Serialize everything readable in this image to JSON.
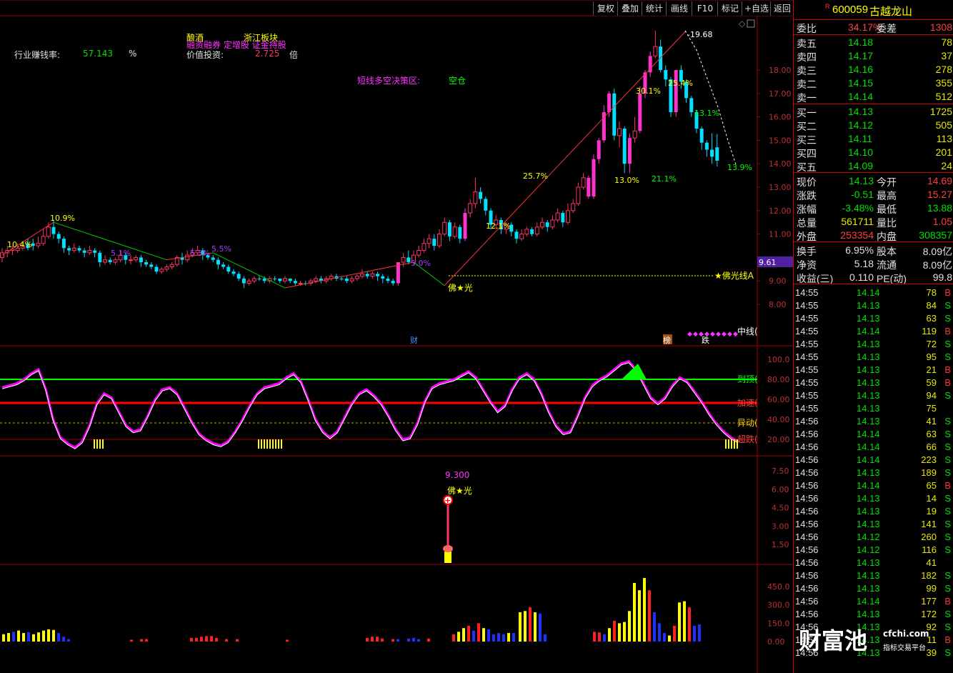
{
  "toolbar": [
    "复权",
    "叠加",
    "统计",
    "画线",
    "F10",
    "标记",
    "+自选",
    "返回"
  ],
  "stock": {
    "flag": "R",
    "code": "600059",
    "name": "古越龙山"
  },
  "overlay": {
    "industry_label": "行业赚钱率:",
    "industry_value": "57.143",
    "industry_unit": "%",
    "tag1": "酿酒",
    "tag2": "浙江板块",
    "tag3": "融资融券 定增股 证金持股",
    "value_label": "价值投资:",
    "value_value": "2.725",
    "value_unit": "倍",
    "decision_label": "短线多空决策区:",
    "decision_value": "空仓"
  },
  "price_axis": [
    "18.00",
    "17.00",
    "16.00",
    "15.00",
    "14.00",
    "13.00",
    "12.00",
    "11.00",
    "9.00",
    "8.00"
  ],
  "current_price_tag": "9.61",
  "peak_label": "19.68",
  "annotations": [
    "30.1%",
    "25.4%",
    "13.1%",
    "13.9%",
    "21.1%",
    "13.0%",
    "25.7%",
    "12.1%",
    "10.9%",
    "10.4%",
    "5.1%",
    "5.3%",
    "5.5%",
    "5.0%"
  ],
  "foguang_line_label": "★佛光线A",
  "foguang_label": "佛★光",
  "events": {
    "cai": "财",
    "bang": "榜",
    "die": "跌",
    "zhongxian": "中线("
  },
  "osc_axis": [
    "100.0",
    "80.00",
    "60.00",
    "40.00",
    "20.00"
  ],
  "osc_lines": {
    "top": "到顶(",
    "accel": "加速(",
    "move": "异动(",
    "drop": "超跌("
  },
  "ind3_axis": [
    "7.50",
    "6.00",
    "4.50",
    "3.00",
    "1.50"
  ],
  "ind3_value": "9.300",
  "vol_axis": [
    "450.0",
    "300.0",
    "150.0",
    "0.00"
  ],
  "quote": {
    "weibi_label": "委比",
    "weibi": "34.17%",
    "weicha_label": "委差",
    "weicha": "1308",
    "sell": [
      {
        "label": "卖五",
        "price": "14.18",
        "vol": "78"
      },
      {
        "label": "卖四",
        "price": "14.17",
        "vol": "37"
      },
      {
        "label": "卖三",
        "price": "14.16",
        "vol": "278"
      },
      {
        "label": "卖二",
        "price": "14.15",
        "vol": "355"
      },
      {
        "label": "卖一",
        "price": "14.14",
        "vol": "512"
      }
    ],
    "buy": [
      {
        "label": "买一",
        "price": "14.13",
        "vol": "1725"
      },
      {
        "label": "买二",
        "price": "14.12",
        "vol": "505"
      },
      {
        "label": "买三",
        "price": "14.11",
        "vol": "113"
      },
      {
        "label": "买四",
        "price": "14.10",
        "vol": "201"
      },
      {
        "label": "买五",
        "price": "14.09",
        "vol": "24"
      }
    ],
    "stats": [
      {
        "l1": "现价",
        "v1": "14.13",
        "c1": "#00e000",
        "l2": "今开",
        "v2": "14.69",
        "c2": "#ff4040"
      },
      {
        "l1": "涨跌",
        "v1": "-0.51",
        "c1": "#00e000",
        "l2": "最高",
        "v2": "15.27",
        "c2": "#ff4040"
      },
      {
        "l1": "涨幅",
        "v1": "-3.48%",
        "c1": "#00e000",
        "l2": "最低",
        "v2": "13.88",
        "c2": "#00e000"
      },
      {
        "l1": "总量",
        "v1": "561711",
        "c1": "#e8e800",
        "l2": "量比",
        "v2": "1.05",
        "c2": "#ff4040"
      },
      {
        "l1": "外盘",
        "v1": "253354",
        "c1": "#ff4040",
        "l2": "内盘",
        "v2": "308357",
        "c2": "#00e000"
      }
    ],
    "stats2": [
      {
        "l1": "换手",
        "v1": "6.95%",
        "l2": "股本",
        "v2": "8.09亿"
      },
      {
        "l1": "净资",
        "v1": "5.18",
        "l2": "流通",
        "v2": "8.09亿"
      },
      {
        "l1": "收益(三)",
        "v1": "0.110",
        "l2": "PE(动)",
        "v2": "99.8"
      }
    ]
  },
  "ticks": [
    {
      "t": "14:55",
      "p": "14.14",
      "v": "78",
      "s": "B"
    },
    {
      "t": "14:55",
      "p": "14.13",
      "v": "84",
      "s": "S"
    },
    {
      "t": "14:55",
      "p": "14.13",
      "v": "63",
      "s": "S"
    },
    {
      "t": "14:55",
      "p": "14.14",
      "v": "119",
      "s": "B"
    },
    {
      "t": "14:55",
      "p": "14.13",
      "v": "72",
      "s": "S"
    },
    {
      "t": "14:55",
      "p": "14.13",
      "v": "95",
      "s": "S"
    },
    {
      "t": "14:55",
      "p": "14.13",
      "v": "21",
      "s": "B"
    },
    {
      "t": "14:55",
      "p": "14.13",
      "v": "59",
      "s": "B"
    },
    {
      "t": "14:55",
      "p": "14.13",
      "v": "94",
      "s": "S"
    },
    {
      "t": "14:55",
      "p": "14.13",
      "v": "75",
      "s": ""
    },
    {
      "t": "14:56",
      "p": "14.13",
      "v": "41",
      "s": "S"
    },
    {
      "t": "14:56",
      "p": "14.14",
      "v": "63",
      "s": "S"
    },
    {
      "t": "14:56",
      "p": "14.14",
      "v": "66",
      "s": "S"
    },
    {
      "t": "14:56",
      "p": "14.14",
      "v": "223",
      "s": "S"
    },
    {
      "t": "14:56",
      "p": "14.13",
      "v": "189",
      "s": "S"
    },
    {
      "t": "14:56",
      "p": "14.14",
      "v": "65",
      "s": "B"
    },
    {
      "t": "14:56",
      "p": "14.13",
      "v": "14",
      "s": "S"
    },
    {
      "t": "14:56",
      "p": "14.13",
      "v": "19",
      "s": "S"
    },
    {
      "t": "14:56",
      "p": "14.13",
      "v": "141",
      "s": "S"
    },
    {
      "t": "14:56",
      "p": "14.12",
      "v": "260",
      "s": "S"
    },
    {
      "t": "14:56",
      "p": "14.12",
      "v": "116",
      "s": "S"
    },
    {
      "t": "14:56",
      "p": "14.13",
      "v": "41",
      "s": ""
    },
    {
      "t": "14:56",
      "p": "14.13",
      "v": "182",
      "s": "S"
    },
    {
      "t": "14:56",
      "p": "14.13",
      "v": "99",
      "s": "S"
    },
    {
      "t": "14:56",
      "p": "14.14",
      "v": "177",
      "s": "B"
    },
    {
      "t": "14:56",
      "p": "14.13",
      "v": "172",
      "s": "S"
    },
    {
      "t": "14:56",
      "p": "14.13",
      "v": "92",
      "s": "S"
    },
    {
      "t": "14:56",
      "p": "14.13",
      "v": "11",
      "s": "B"
    },
    {
      "t": "14:56",
      "p": "14.13",
      "v": "39",
      "s": "S"
    }
  ],
  "watermark": {
    "main": "财富池",
    "domain": "cfchi.com",
    "sub": "指标交易平台"
  },
  "colors": {
    "up": "#ff3366",
    "down": "#00e0ff",
    "up_magenta": "#ff33cc",
    "osc": "#ff00ff",
    "green_line": "#00ff00",
    "red_line": "#ff0000"
  }
}
